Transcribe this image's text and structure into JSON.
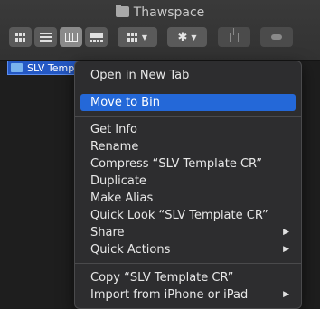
{
  "window": {
    "title": "Thawspace",
    "title_icon": "folder-icon"
  },
  "toolbar": {
    "buttons": [
      {
        "name": "icon-view",
        "icon": "grid-icon"
      },
      {
        "name": "list-view",
        "icon": "list-icon"
      },
      {
        "name": "column-view",
        "icon": "columns-icon",
        "selected": true
      },
      {
        "name": "gallery-view",
        "icon": "gallery-icon"
      },
      {
        "name": "group-by",
        "icon": "grid-icon"
      },
      {
        "name": "action",
        "icon": "gear-icon"
      },
      {
        "name": "share",
        "icon": "share-icon"
      },
      {
        "name": "tags",
        "icon": "tag-icon"
      }
    ]
  },
  "file": {
    "label": "SLV Template CR"
  },
  "menu": {
    "items": [
      {
        "label": "Open in New Tab"
      },
      {
        "label": "Move to Bin",
        "highlighted": true
      },
      {
        "label": "Get Info"
      },
      {
        "label": "Rename"
      },
      {
        "label": "Compress “SLV Template CR”"
      },
      {
        "label": "Duplicate"
      },
      {
        "label": "Make Alias"
      },
      {
        "label": "Quick Look “SLV Template CR”"
      },
      {
        "label": "Share",
        "submenu": true
      },
      {
        "label": "Quick Actions",
        "submenu": true
      },
      {
        "label": "Copy “SLV Template CR”"
      },
      {
        "label": "Import from iPhone or iPad",
        "submenu": true
      }
    ],
    "arrow_glyph": "▶"
  }
}
